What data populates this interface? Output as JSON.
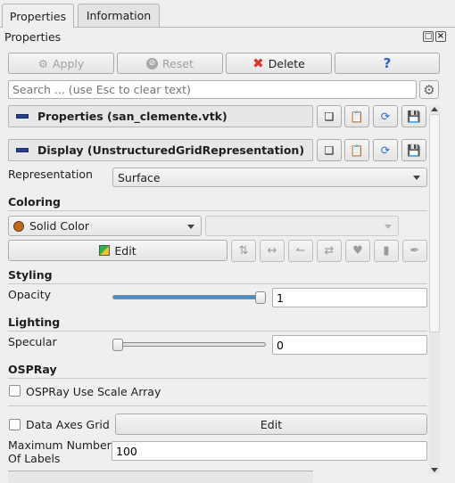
{
  "tabs": [
    {
      "label": "Properties"
    },
    {
      "label": "Information"
    }
  ],
  "panel_title": "Properties",
  "toolbar": {
    "apply": "Apply",
    "reset": "Reset",
    "delete": "Delete",
    "help": "?"
  },
  "search": {
    "placeholder": "Search ... (use Esc to clear text)"
  },
  "sections": {
    "properties": "Properties (san_clemente.vtk)",
    "display": "Display (UnstructuredGridRepresentation)"
  },
  "representation": {
    "label": "Representation",
    "value": "Surface"
  },
  "coloring": {
    "heading": "Coloring",
    "value": "Solid Color",
    "second_value": "",
    "edit": "Edit"
  },
  "styling": {
    "heading": "Styling",
    "opacity_label": "Opacity",
    "opacity_value": "1",
    "opacity_fraction": 1.0
  },
  "lighting": {
    "heading": "Lighting",
    "specular_label": "Specular",
    "specular_value": "0",
    "specular_fraction": 0.0
  },
  "ospray": {
    "heading": "OSPRay",
    "use_scale_array": "OSPRay Use Scale Array"
  },
  "data_axes": {
    "label": "Data Axes Grid",
    "edit": "Edit"
  },
  "max_labels": {
    "label_line1": "Maximum Number",
    "label_line2": "Of Labels",
    "value": "100"
  },
  "colors": {
    "delete_x": "#d9352a",
    "help": "#2a5fcb",
    "section_dash": "#2a3f8f",
    "refresh": "#2a6fd0",
    "save": "#1f3c86",
    "accent": "#3f8fd6",
    "solid_color_swatch": "#c06a1c"
  }
}
